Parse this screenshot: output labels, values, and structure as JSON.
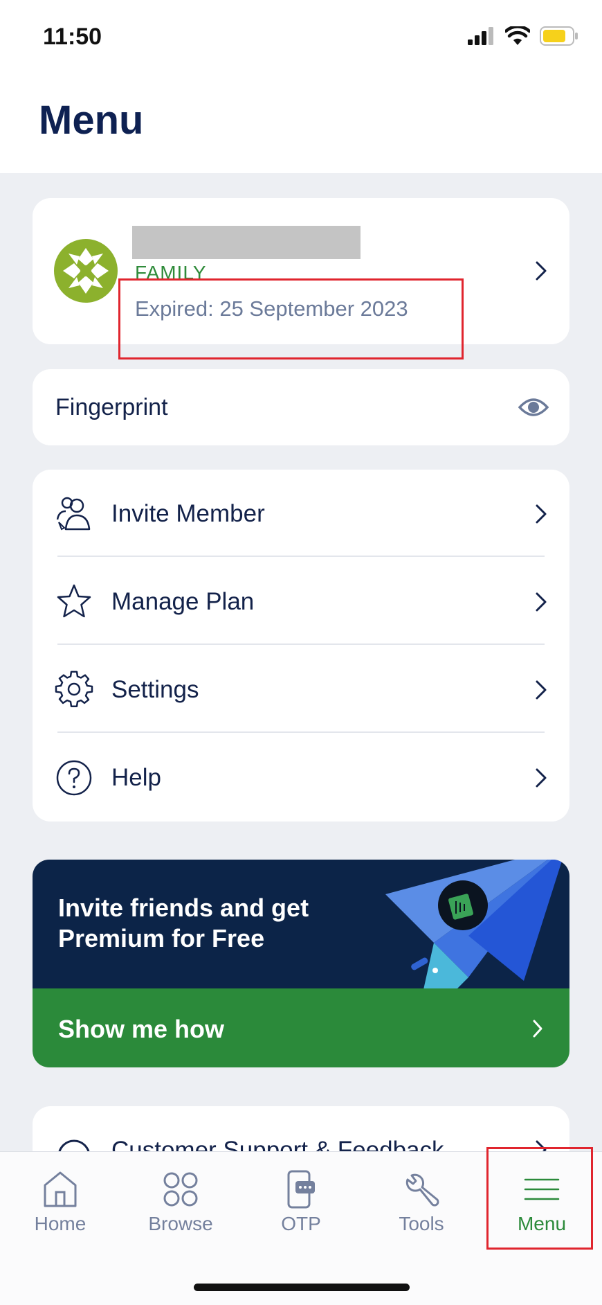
{
  "status_bar": {
    "time": "11:50",
    "battery_color": "#f6d11b"
  },
  "header": {
    "title": "Menu"
  },
  "account": {
    "plan": "FAMILY",
    "expired": "Expired: 25 September 2023",
    "avatar_color": "#8cb12d"
  },
  "fingerprint": {
    "label": "Fingerprint",
    "icon": "eye-icon"
  },
  "menu": {
    "items": [
      {
        "label": "Invite Member",
        "icon": "invite-member-icon"
      },
      {
        "label": "Manage Plan",
        "icon": "star-icon"
      },
      {
        "label": "Settings",
        "icon": "gear-icon"
      },
      {
        "label": "Help",
        "icon": "help-icon"
      }
    ]
  },
  "promo": {
    "text": "Invite friends and get Premium for Free",
    "cta": "Show me how",
    "bg_color": "#0c2448",
    "cta_color": "#2b8a3a"
  },
  "support": {
    "label": "Customer Support & Feedback",
    "icon": "headset-icon"
  },
  "tabbar": {
    "tabs": [
      {
        "label": "Home",
        "icon": "home-icon"
      },
      {
        "label": "Browse",
        "icon": "browse-icon"
      },
      {
        "label": "OTP",
        "icon": "otp-icon"
      },
      {
        "label": "Tools",
        "icon": "wrench-icon"
      },
      {
        "label": "Menu",
        "icon": "menu-lines-icon"
      }
    ],
    "active": "Menu",
    "active_color": "#2b8a3a"
  }
}
